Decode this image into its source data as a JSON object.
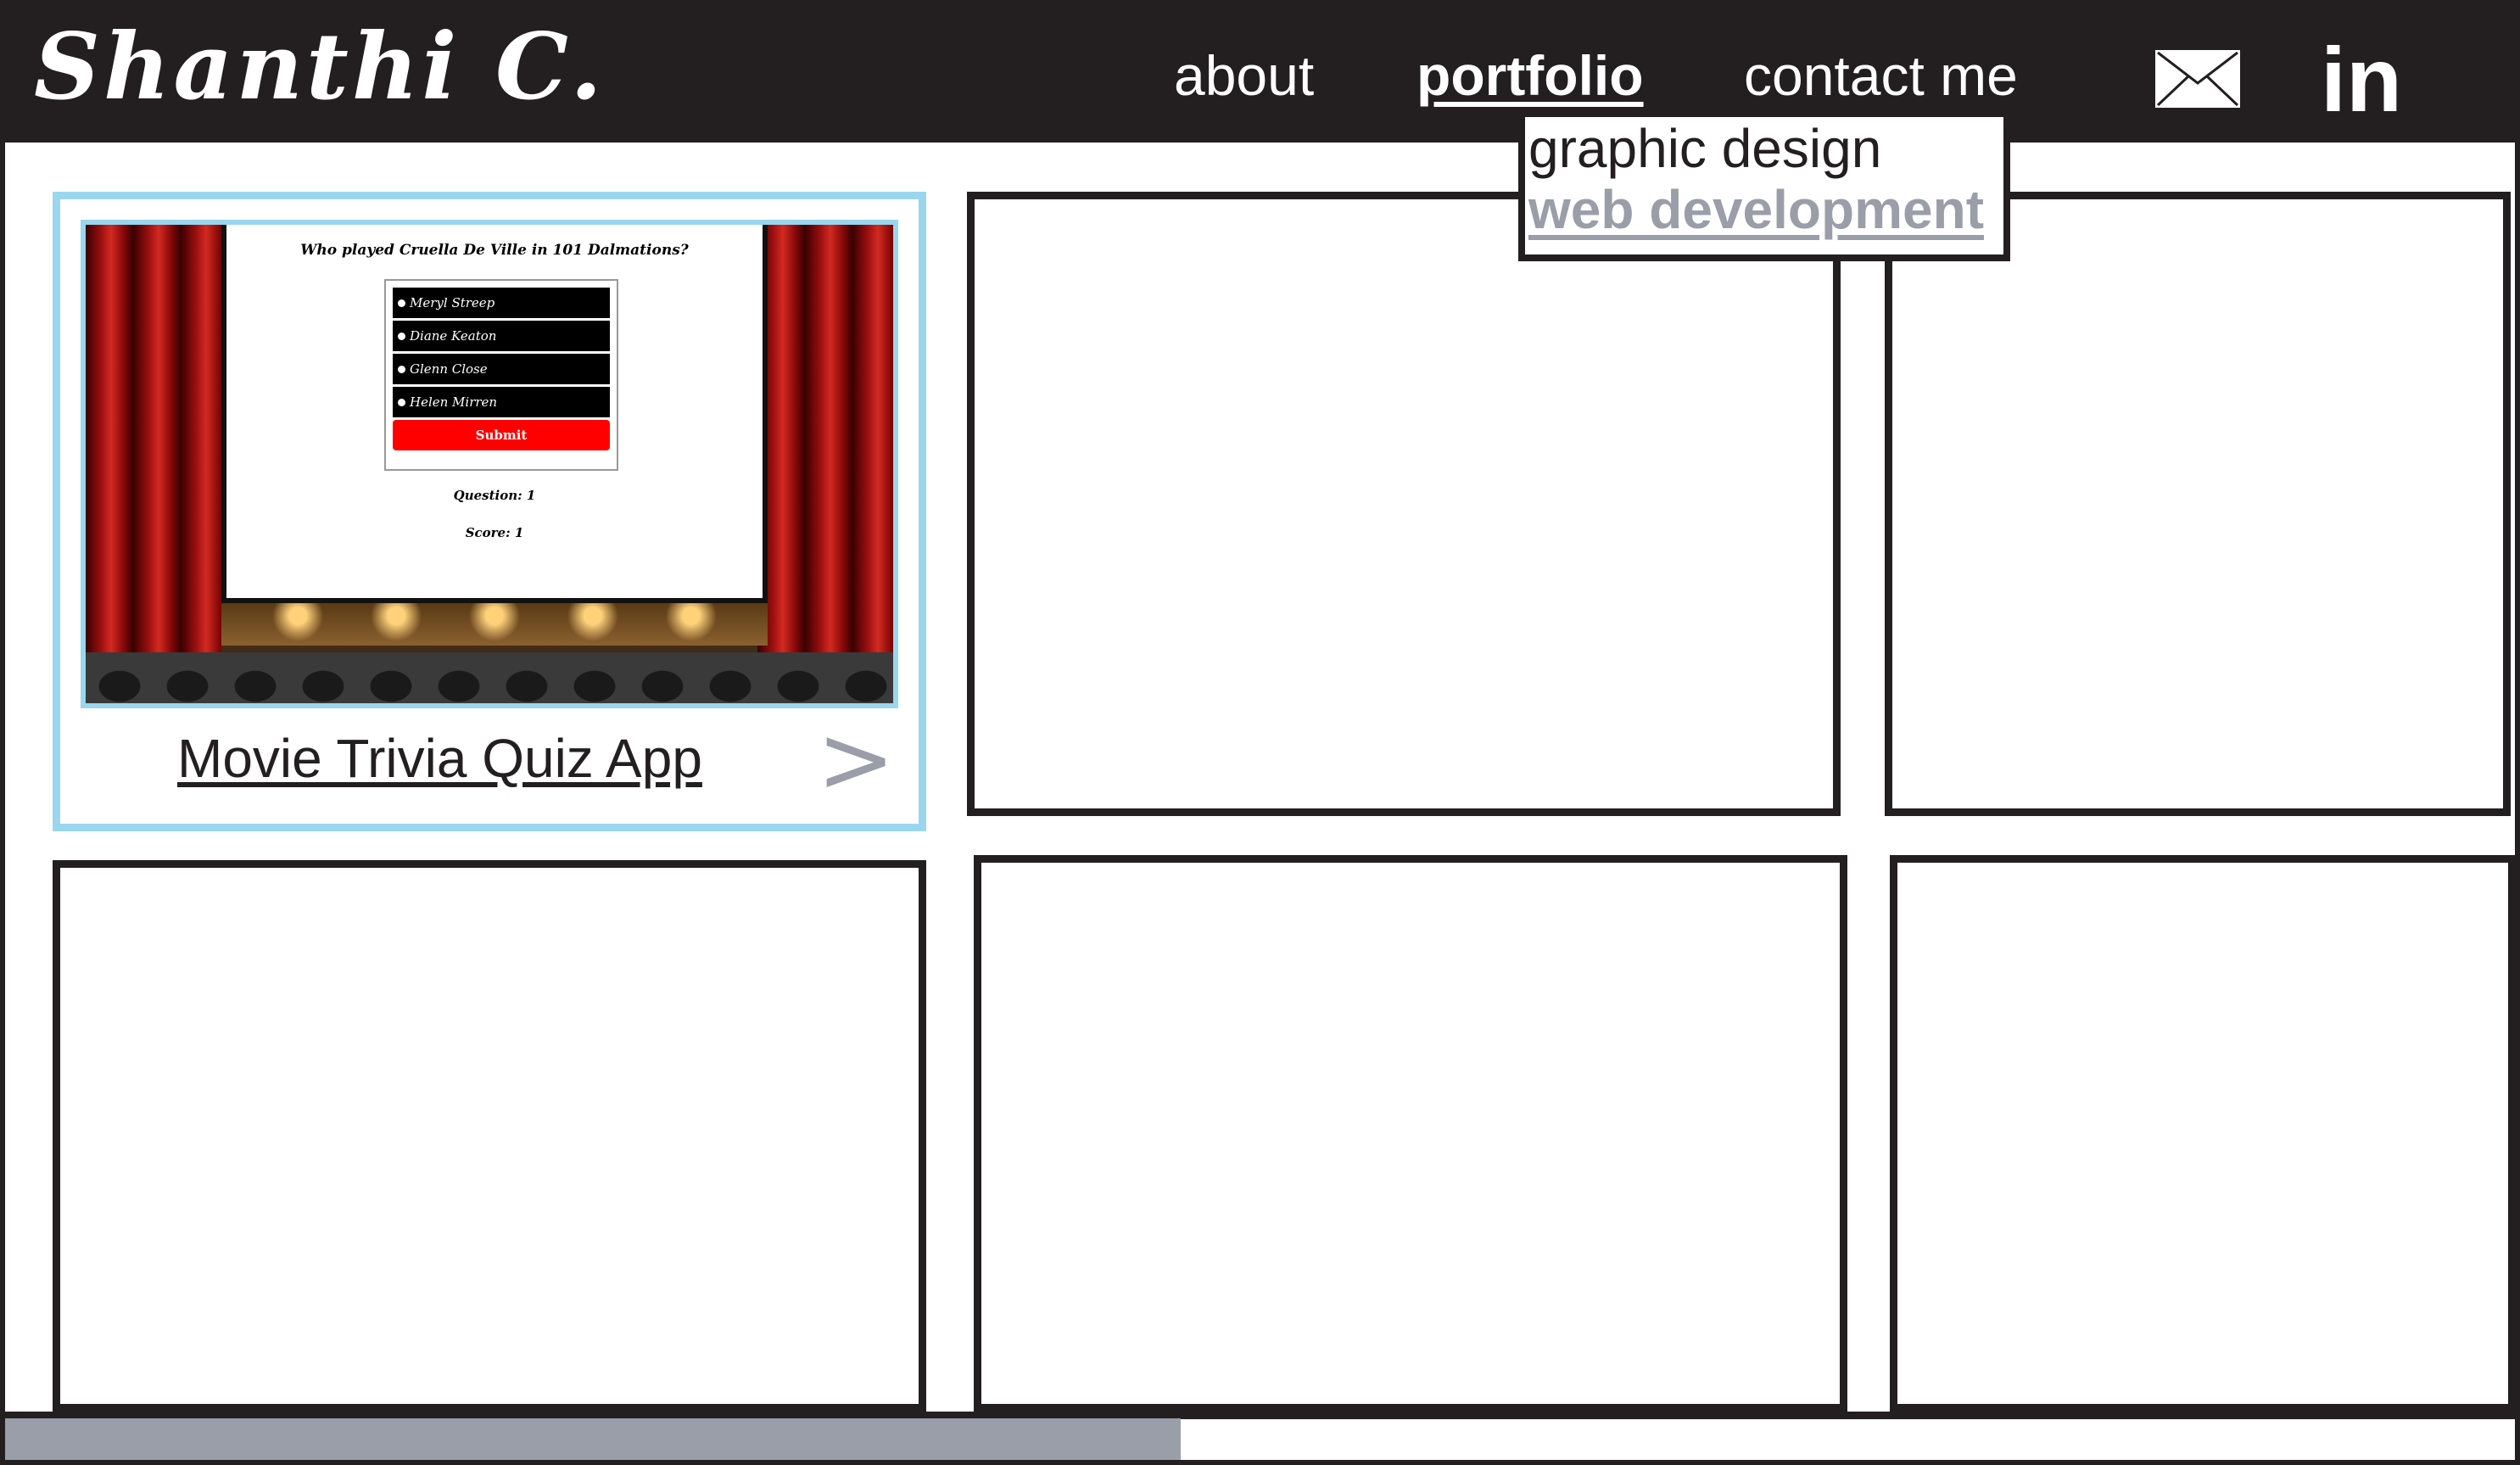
{
  "header": {
    "logo_text": "Shanthi C.",
    "nav": {
      "about": "about",
      "portfolio": "portfolio",
      "contact": "contact me"
    },
    "icons": [
      "mail-icon",
      "linkedin-icon"
    ],
    "linkedin_label": "in"
  },
  "dropdown": {
    "items": [
      "graphic design",
      "web development"
    ],
    "active_item": "web development"
  },
  "portfolio": {
    "featured": {
      "title": "Movie Trivia Quiz App",
      "arrow": ">",
      "preview": {
        "question": "Who played Cruella De Ville in 101 Dalmations?",
        "options": [
          "Meryl Streep",
          "Diane Keaton",
          "Glenn Close",
          "Helen Mirren"
        ],
        "submit_label": "Submit",
        "question_counter": "Question: 1",
        "score": "Score: 1"
      }
    },
    "empty_card_count": 5
  },
  "colors": {
    "header_bg": "#231f20",
    "accent_blue": "#9ad6ee",
    "muted_gray": "#999ea9",
    "submit_red": "#ff0000"
  },
  "scrollbar": {
    "position_fraction": 0.47
  }
}
